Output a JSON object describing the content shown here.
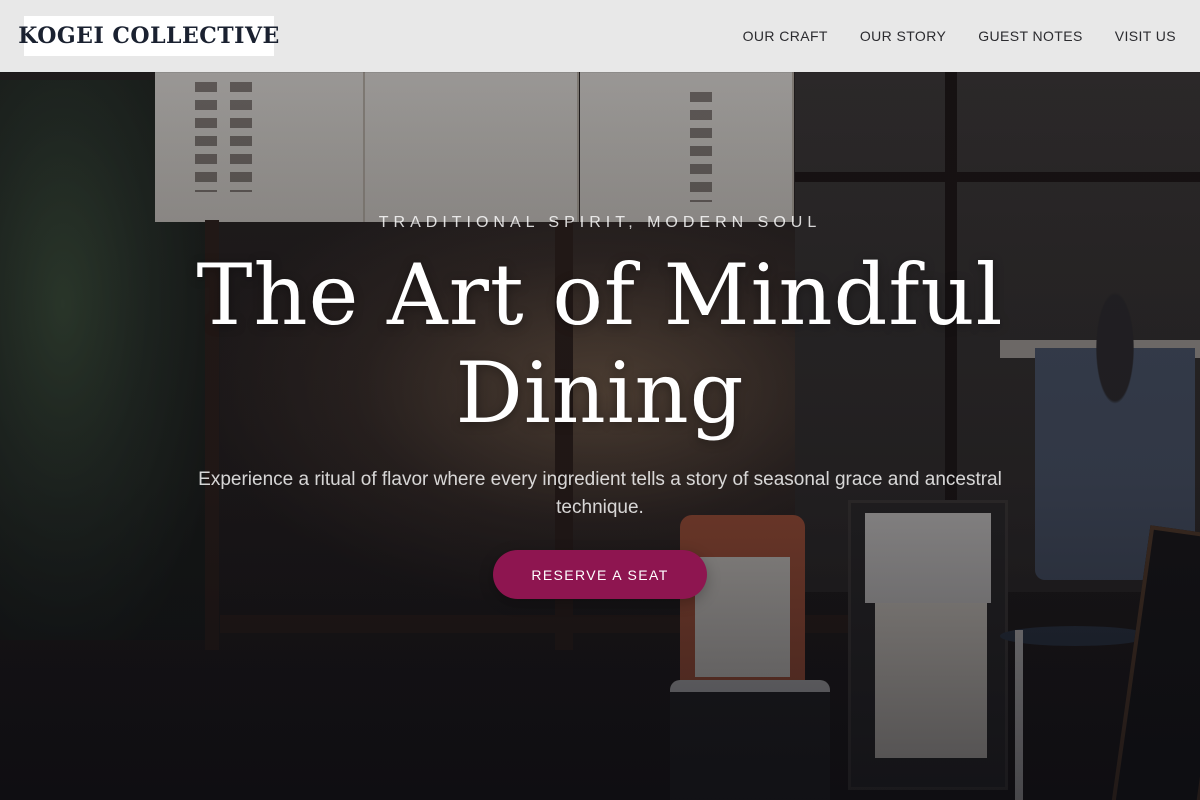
{
  "brand": {
    "name": "KOGEI COLLECTIVE"
  },
  "nav": {
    "items": [
      {
        "label": "OUR CRAFT"
      },
      {
        "label": "OUR STORY"
      },
      {
        "label": "GUEST NOTES"
      },
      {
        "label": "VISIT US"
      }
    ]
  },
  "hero": {
    "eyebrow": "TRADITIONAL SPIRIT, MODERN SOUL",
    "title": "The Art of Mindful Dining",
    "subtitle": "Experience a ritual of flavor where every ingredient tells a story of seasonal grace and ancestral technique.",
    "cta_label": "RESERVE A SEAT",
    "background_image": "night-restaurant-storefront-photo"
  },
  "colors": {
    "accent": "#8e1550",
    "header_bg": "#f8f8f7",
    "logo_text": "#1a2130",
    "nav_text": "#2b2b2f"
  }
}
